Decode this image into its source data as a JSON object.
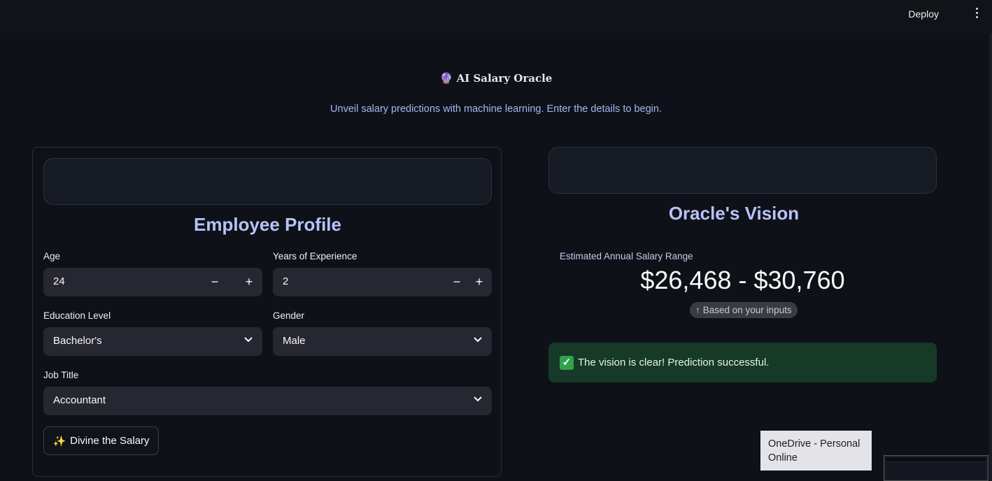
{
  "topbar": {
    "deploy_label": "Deploy"
  },
  "header": {
    "title_icon": "🔮",
    "title": "AI Salary Oracle",
    "subtitle": "Unveil salary predictions with machine learning. Enter the details to begin."
  },
  "profile": {
    "heading": "Employee Profile",
    "age": {
      "label": "Age",
      "value": "24"
    },
    "experience": {
      "label": "Years of Experience",
      "value": "2"
    },
    "education": {
      "label": "Education Level",
      "value": "Bachelor's"
    },
    "gender": {
      "label": "Gender",
      "value": "Male"
    },
    "job_title": {
      "label": "Job Title",
      "value": "Accountant"
    },
    "step_minus": "−",
    "step_plus": "+",
    "submit_icon": "✨",
    "submit_label": "Divine the Salary"
  },
  "vision": {
    "heading": "Oracle's Vision",
    "metric_label": "Estimated Annual Salary Range",
    "metric_value": "$26,468 - $30,760",
    "delta_arrow": "↑",
    "delta_text": "Based on your inputs",
    "success_icon": "✓",
    "success_text": "The vision is clear! Prediction successful."
  },
  "tooltip": {
    "line1": "OneDrive - Personal",
    "line2": "Online"
  },
  "colors": {
    "background": "#0e1118",
    "accent_heading": "#b7c3f7",
    "success_bg": "#173928",
    "input_bg": "#262730"
  }
}
